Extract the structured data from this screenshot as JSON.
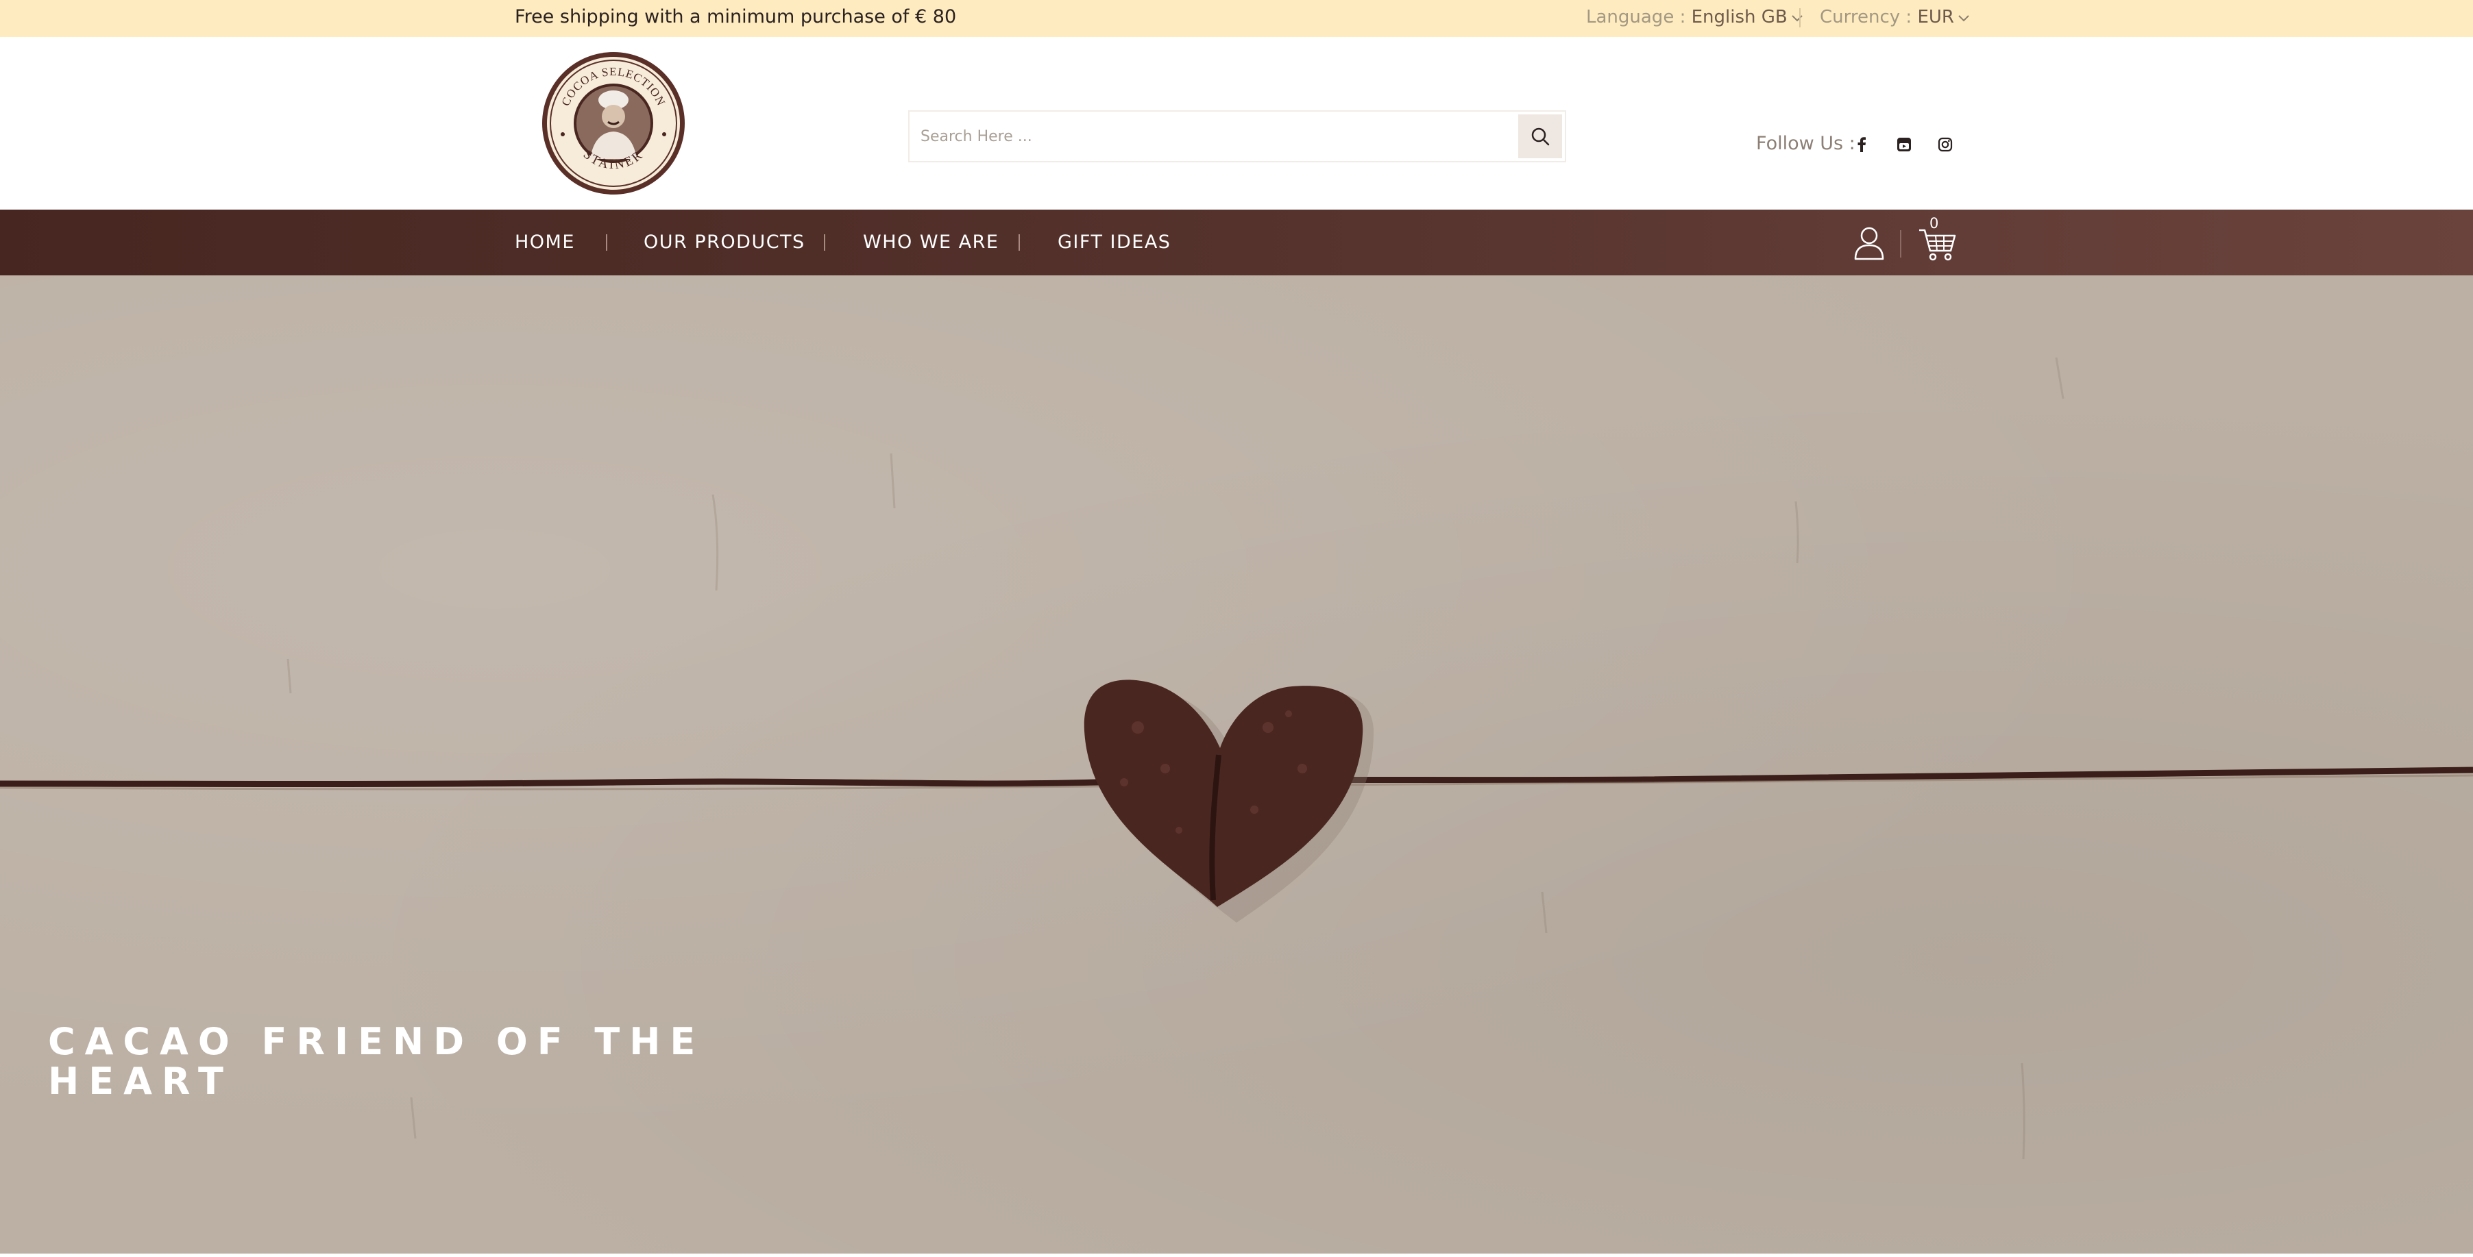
{
  "topbar": {
    "promo": "Free shipping with a minimum purchase of € 80",
    "language_label": "Language : ",
    "language_value": "English GB",
    "currency_label": "Currency : ",
    "currency_value": "EUR"
  },
  "header": {
    "logo_icon": "cocoa-selection-stainer-logo",
    "logo_text_top": "COCOA SELECTION",
    "logo_text_bottom": "STAINER",
    "search": {
      "placeholder": "Search Here ...",
      "value": ""
    },
    "follow_label": "Follow Us :",
    "social": [
      "facebook-icon",
      "youtube-icon",
      "instagram-icon"
    ]
  },
  "nav": {
    "items": [
      {
        "label": "HOME"
      },
      {
        "label": "OUR PRODUCTS"
      },
      {
        "label": "WHO WE ARE"
      },
      {
        "label": "GIFT IDEAS"
      }
    ],
    "cart_count": "0"
  },
  "hero": {
    "title_line1": "CACAO FRIEND OF THE",
    "title_line2": "HEART"
  },
  "colors": {
    "topbar_bg": "#feebbf",
    "nav_bg": "#4f2d27",
    "hero_bg": "#bcb0a4",
    "heart": "#4a2621"
  }
}
